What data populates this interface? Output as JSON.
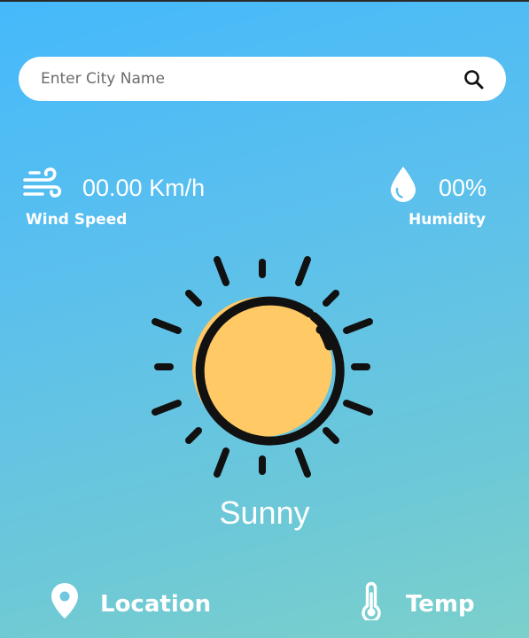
{
  "search": {
    "placeholder": "Enter City Name",
    "value": "",
    "icon": "search-icon"
  },
  "wind": {
    "icon": "wind-icon",
    "value": "00.00 Km/h",
    "label": "Wind Speed"
  },
  "humidity": {
    "icon": "water-drop-icon",
    "value": "00%",
    "label": "Humidity"
  },
  "weather": {
    "icon": "sun-icon",
    "condition": "Sunny"
  },
  "location": {
    "icon": "location-pin-icon",
    "label": "Location"
  },
  "temperature": {
    "icon": "thermometer-icon",
    "label": "Temp"
  },
  "colors": {
    "background_top": "#45b9fb",
    "background_bottom": "#7cd0cb",
    "sun_fill": "#ffc966",
    "sun_outline": "#111111",
    "text": "#ffffff"
  }
}
